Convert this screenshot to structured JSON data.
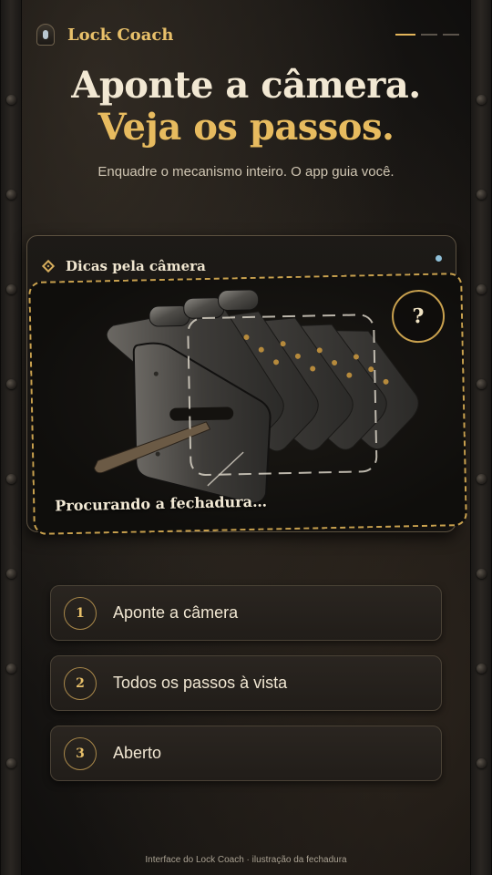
{
  "header": {
    "app_name": "Lock Coach",
    "logo_icon": "keyhole-shield-icon",
    "pager": {
      "count": 3,
      "active_index": 0
    }
  },
  "hero": {
    "title_line1": "Aponte a câmera.",
    "title_line2": "Veja os passos.",
    "subtitle": "Enquadre o mecanismo inteiro. O app guia você."
  },
  "camera_card": {
    "title": "Dicas pela câmera",
    "title_icon": "diamond-icon",
    "help_label": "?",
    "status": "Procurando a fechadura…"
  },
  "steps": [
    {
      "number": "1",
      "label": "Aponte a câmera"
    },
    {
      "number": "2",
      "label": "Todos os passos à vista"
    },
    {
      "number": "3",
      "label": "Aberto"
    }
  ],
  "footer": {
    "caption": "Interface do Lock Coach · ilustração da fechadura"
  },
  "colors": {
    "accent_gold": "#e7bb5f",
    "text_light": "#f2e8d3",
    "status_dot": "#8fc0d8",
    "background": "#161412"
  }
}
